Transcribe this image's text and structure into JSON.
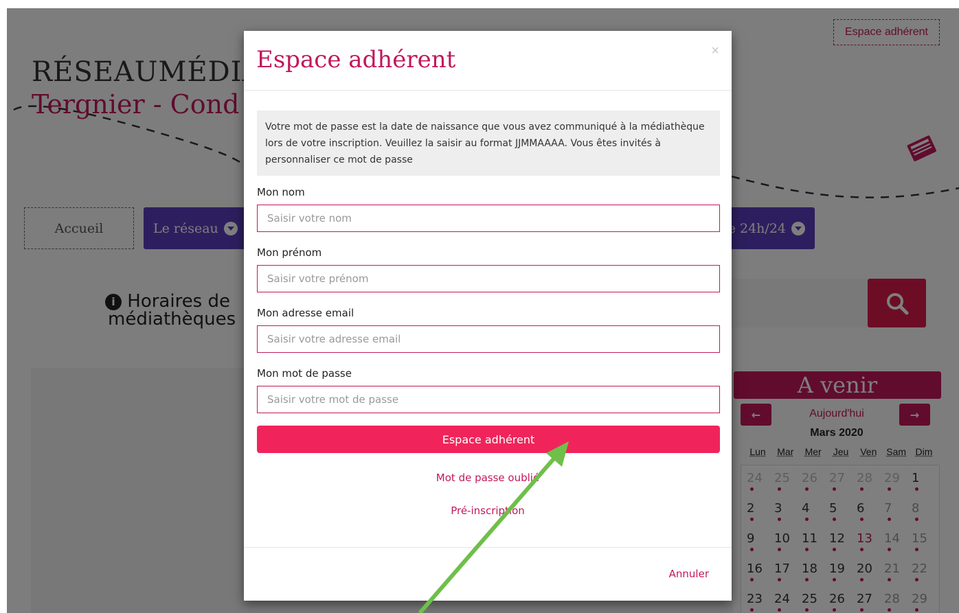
{
  "background": {
    "logo_line1": "RÉSEAUMÉDIA",
    "logo_line2": "Tergnier - Cond",
    "top_link": "Espace adhérent",
    "nav": {
      "home": "Accueil",
      "reseau": "Le réseau",
      "h24": "e 24h/24"
    },
    "horaires_line1": "Horaires de",
    "horaires_line2": "médiathèques",
    "agenda": {
      "title": "A venir",
      "today": "Aujourd'hui",
      "month": "Mars 2020",
      "days": [
        "Lun",
        "Mar",
        "Mer",
        "Jeu",
        "Ven",
        "Sam",
        "Dim"
      ],
      "weeks": [
        [
          "24",
          "25",
          "26",
          "27",
          "28",
          "29",
          "1"
        ],
        [
          "2",
          "3",
          "4",
          "5",
          "6",
          "7",
          "8"
        ],
        [
          "9",
          "10",
          "11",
          "12",
          "13",
          "14",
          "15"
        ],
        [
          "16",
          "17",
          "18",
          "19",
          "20",
          "21",
          "22"
        ],
        [
          "23",
          "24",
          "25",
          "26",
          "27",
          "28",
          "29"
        ]
      ]
    }
  },
  "modal": {
    "title": "Espace adhérent",
    "close": "×",
    "info": "Votre mot de passe est la date de naissance que vous avez communiqué à la médiathèque lors de votre inscription. Veuillez la saisir au format JJMMAAAA. Vous êtes invités à personnaliser ce mot de passe",
    "fields": {
      "nom_label": "Mon nom",
      "nom_placeholder": "Saisir votre nom",
      "prenom_label": "Mon prénom",
      "prenom_placeholder": "Saisir votre prénom",
      "email_label": "Mon adresse email",
      "email_placeholder": "Saisir votre adresse email",
      "password_label": "Mon mot de passe",
      "password_placeholder": "Saisir votre mot de passe"
    },
    "submit": "Espace adhérent",
    "forgot": "Mot de passe oublié",
    "preinscription": "Pré-inscription",
    "cancel": "Annuler"
  },
  "colors": {
    "accent": "#c2185b",
    "button": "#f0245b",
    "nav": "#5b3fbf",
    "annotation_arrow": "#6fbf4a"
  }
}
